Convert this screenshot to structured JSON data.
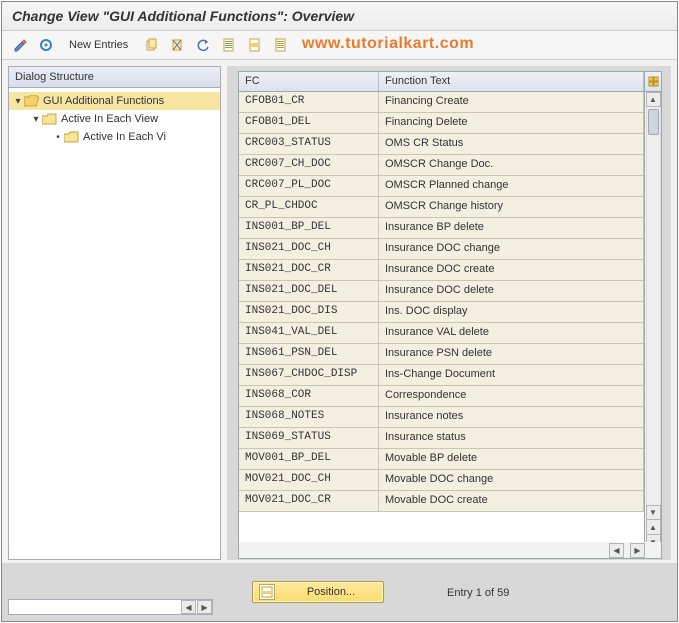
{
  "title": "Change View \"GUI Additional Functions\": Overview",
  "watermark": "www.tutorialkart.com",
  "toolbar": {
    "new_entries": "New Entries"
  },
  "tree": {
    "header": "Dialog Structure",
    "items": [
      {
        "label": "GUI Additional Functions",
        "expanded": true,
        "selected": true
      },
      {
        "label": "Active In Each View",
        "expanded": true,
        "selected": false
      },
      {
        "label": "Active In Each Vi",
        "expanded": false,
        "selected": false
      }
    ]
  },
  "table": {
    "col_fc": "FC",
    "col_ft": "Function Text",
    "rows": [
      {
        "fc": "CFOB01_CR",
        "ft": "Financing Create"
      },
      {
        "fc": "CFOB01_DEL",
        "ft": "Financing Delete"
      },
      {
        "fc": "CRC003_STATUS",
        "ft": "OMS CR Status"
      },
      {
        "fc": "CRC007_CH_DOC",
        "ft": "OMSCR Change Doc."
      },
      {
        "fc": "CRC007_PL_DOC",
        "ft": "OMSCR Planned change"
      },
      {
        "fc": "CR_PL_CHDOC",
        "ft": "OMSCR Change history"
      },
      {
        "fc": "INS001_BP_DEL",
        "ft": "Insurance BP delete"
      },
      {
        "fc": "INS021_DOC_CH",
        "ft": "Insurance DOC change"
      },
      {
        "fc": "INS021_DOC_CR",
        "ft": "Insurance DOC create"
      },
      {
        "fc": "INS021_DOC_DEL",
        "ft": "Insurance DOC delete"
      },
      {
        "fc": "INS021_DOC_DIS",
        "ft": "Ins. DOC display"
      },
      {
        "fc": "INS041_VAL_DEL",
        "ft": "Insurance VAL delete"
      },
      {
        "fc": "INS061_PSN_DEL",
        "ft": "Insurance PSN delete"
      },
      {
        "fc": "INS067_CHDOC_DISP",
        "ft": "Ins-Change Document"
      },
      {
        "fc": "INS068_COR",
        "ft": "Correspondence"
      },
      {
        "fc": "INS068_NOTES",
        "ft": "Insurance notes"
      },
      {
        "fc": "INS069_STATUS",
        "ft": "Insurance status"
      },
      {
        "fc": "MOV001_BP_DEL",
        "ft": "Movable BP delete"
      },
      {
        "fc": "MOV021_DOC_CH",
        "ft": "Movable DOC change"
      },
      {
        "fc": "MOV021_DOC_CR",
        "ft": "Movable DOC create"
      }
    ]
  },
  "footer": {
    "position_label": "Position...",
    "entry_text": "Entry 1 of 59"
  }
}
